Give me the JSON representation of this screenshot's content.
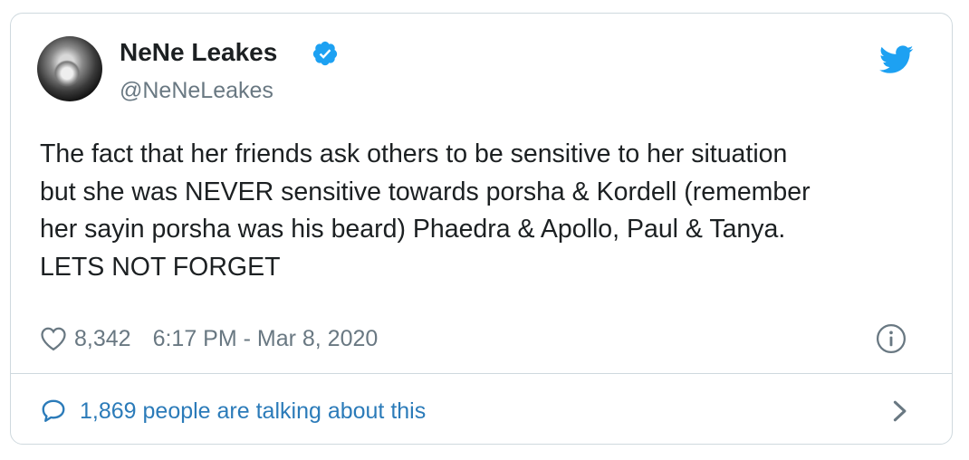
{
  "tweet": {
    "author_name": "NeNe Leakes",
    "author_handle": "@NeNeLeakes",
    "text_lines": [
      "The fact that her friends ask others to be sensitive to her situation",
      "but she was NEVER sensitive towards porsha & Kordell (remember",
      "her sayin porsha was his beard) Phaedra & Apollo, Paul & Tanya.",
      "LETS NOT FORGET"
    ],
    "likes": "8,342",
    "timestamp": "6:17 PM - Mar 8, 2020",
    "conversation": "1,869 people are talking about this"
  },
  "icons": {
    "verified": "verified-badge-icon",
    "twitter": "twitter-bird-icon",
    "like": "heart-icon",
    "info": "info-icon",
    "reply": "speech-bubble-icon",
    "chevron": "chevron-right-icon"
  },
  "colors": {
    "twitter_blue": "#1da1f2",
    "link_blue": "#2b7bb9",
    "muted": "#697882",
    "text": "#1c2022",
    "border": "#cfd9de"
  }
}
